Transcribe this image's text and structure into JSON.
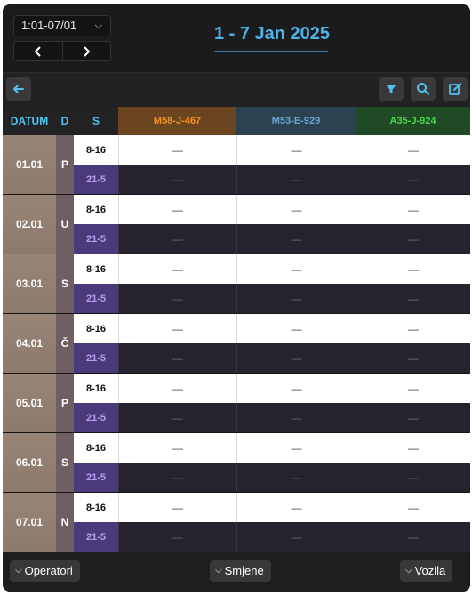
{
  "header": {
    "range_value": "1:01-07/01",
    "prev_label": "‹",
    "next_label": "›",
    "title": "1 - 7 Jan 2025"
  },
  "toolbar": {
    "back_icon": "arrow-left-icon",
    "filter_icon": "filter-icon",
    "search_icon": "search-icon",
    "edit_icon": "edit-icon"
  },
  "table": {
    "headers": {
      "date": "DATUM",
      "dow": "D",
      "shift": "S"
    },
    "vehicles": [
      {
        "name": "M58-J-467",
        "color": "#f2921e",
        "bg": "#6a4520"
      },
      {
        "name": "M53-E-929",
        "color": "#6aa6d6",
        "bg": "#2d4250"
      },
      {
        "name": "A35-J-924",
        "color": "#4cd64c",
        "bg": "#1f4a25"
      }
    ],
    "shifts": {
      "day": "8-16",
      "night": "21-5"
    },
    "empty_value": "—",
    "days": [
      {
        "date": "01.01",
        "dow": "P"
      },
      {
        "date": "02.01",
        "dow": "U"
      },
      {
        "date": "03.01",
        "dow": "S"
      },
      {
        "date": "04.01",
        "dow": "Č"
      },
      {
        "date": "05.01",
        "dow": "P"
      },
      {
        "date": "06.01",
        "dow": "S"
      },
      {
        "date": "07.01",
        "dow": "N"
      }
    ]
  },
  "footer": {
    "operators_label": "Operatori",
    "shifts_label": "Smjene",
    "vehicles_label": "Vozila"
  }
}
